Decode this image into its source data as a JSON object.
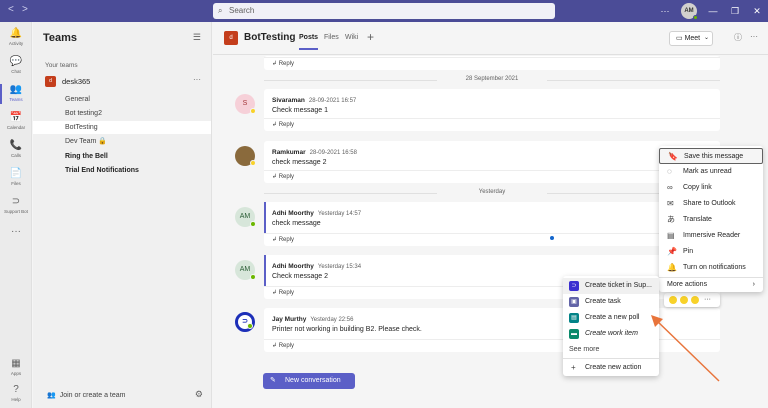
{
  "titlebar": {
    "back": "<",
    "forward": ">",
    "search_placeholder": "Search",
    "more": "···",
    "avatar_initials": "AM",
    "minimize": "—",
    "maximize": "❐",
    "close": "✕"
  },
  "rail": [
    {
      "icon": "🔔",
      "label": "Activity"
    },
    {
      "icon": "💬",
      "label": "Chat"
    },
    {
      "icon": "👥",
      "label": "Teams"
    },
    {
      "icon": "📅",
      "label": "Calendar"
    },
    {
      "icon": "📞",
      "label": "Calls"
    },
    {
      "icon": "📄",
      "label": "Files"
    },
    {
      "icon": "⊃",
      "label": "Support Bot"
    },
    {
      "icon": "···",
      "label": ""
    },
    {
      "icon": "▦",
      "label": "Apps"
    },
    {
      "icon": "?",
      "label": "Help"
    }
  ],
  "teams_panel": {
    "title": "Teams",
    "section": "Your teams",
    "team_name": "desk365",
    "team_logo": "d",
    "more": "···",
    "channels": [
      "General",
      "Bot testing2",
      "BotTesting",
      "Dev Team 🔒",
      "Ring the Bell",
      "Trial End Notifications"
    ],
    "join_label": "Join or create a team"
  },
  "channel": {
    "logo": "d",
    "title": "BotTesting",
    "tabs": [
      "Posts",
      "Files",
      "Wiki"
    ],
    "plus": "+",
    "meet": "Meet"
  },
  "posts": {
    "reply": "Reply",
    "dates": [
      "28 September 2021",
      "Yesterday"
    ],
    "messages": [
      {
        "initials": "S",
        "author": "Sivaraman",
        "time": "28-09-2021 16:57",
        "text": "Check message 1"
      },
      {
        "initials": "",
        "author": "Ramkumar",
        "time": "28-09-2021 16:58",
        "text": "check message 2"
      },
      {
        "initials": "AM",
        "author": "Adhi Moorthy",
        "time": "Yesterday 14:57",
        "text": "check message"
      },
      {
        "initials": "AM",
        "author": "Adhi Moorthy",
        "time": "Yesterday 15:34",
        "text": "Check message 2"
      },
      {
        "initials": "",
        "author": "Jay Murthy",
        "time": "Yesterday 22:56",
        "text": "Printer not working in building B2. Please check."
      }
    ],
    "new_conversation": "New conversation"
  },
  "more_options_menu": [
    {
      "icon": "bookmark-icon",
      "label": "Save this message"
    },
    {
      "icon": "unread-icon",
      "label": "Mark as unread"
    },
    {
      "icon": "link-icon",
      "label": "Copy link"
    },
    {
      "icon": "mail-icon",
      "label": "Share to Outlook"
    },
    {
      "icon": "translate-icon",
      "label": "Translate"
    },
    {
      "icon": "reader-icon",
      "label": "Immersive Reader"
    },
    {
      "icon": "pin-icon",
      "label": "Pin"
    },
    {
      "icon": "bell-icon",
      "label": "Turn on notifications"
    },
    {
      "icon": "",
      "label": "More actions"
    }
  ],
  "actions_menu": {
    "items": [
      {
        "label": "Create ticket in Sup...",
        "color": "#3b2fd0"
      },
      {
        "label": "Create task",
        "color": "#6264a7"
      },
      {
        "label": "Create a new poll",
        "color": "#038387"
      },
      {
        "label": "Create work item",
        "color": "#0b8a6b"
      }
    ],
    "see_more": "See more",
    "create_new": "Create new action"
  },
  "colors": {
    "accent": "#5b5fc7",
    "titlebar": "#4b4c97",
    "team": "#c43e1c",
    "arrow": "#e8743b"
  }
}
